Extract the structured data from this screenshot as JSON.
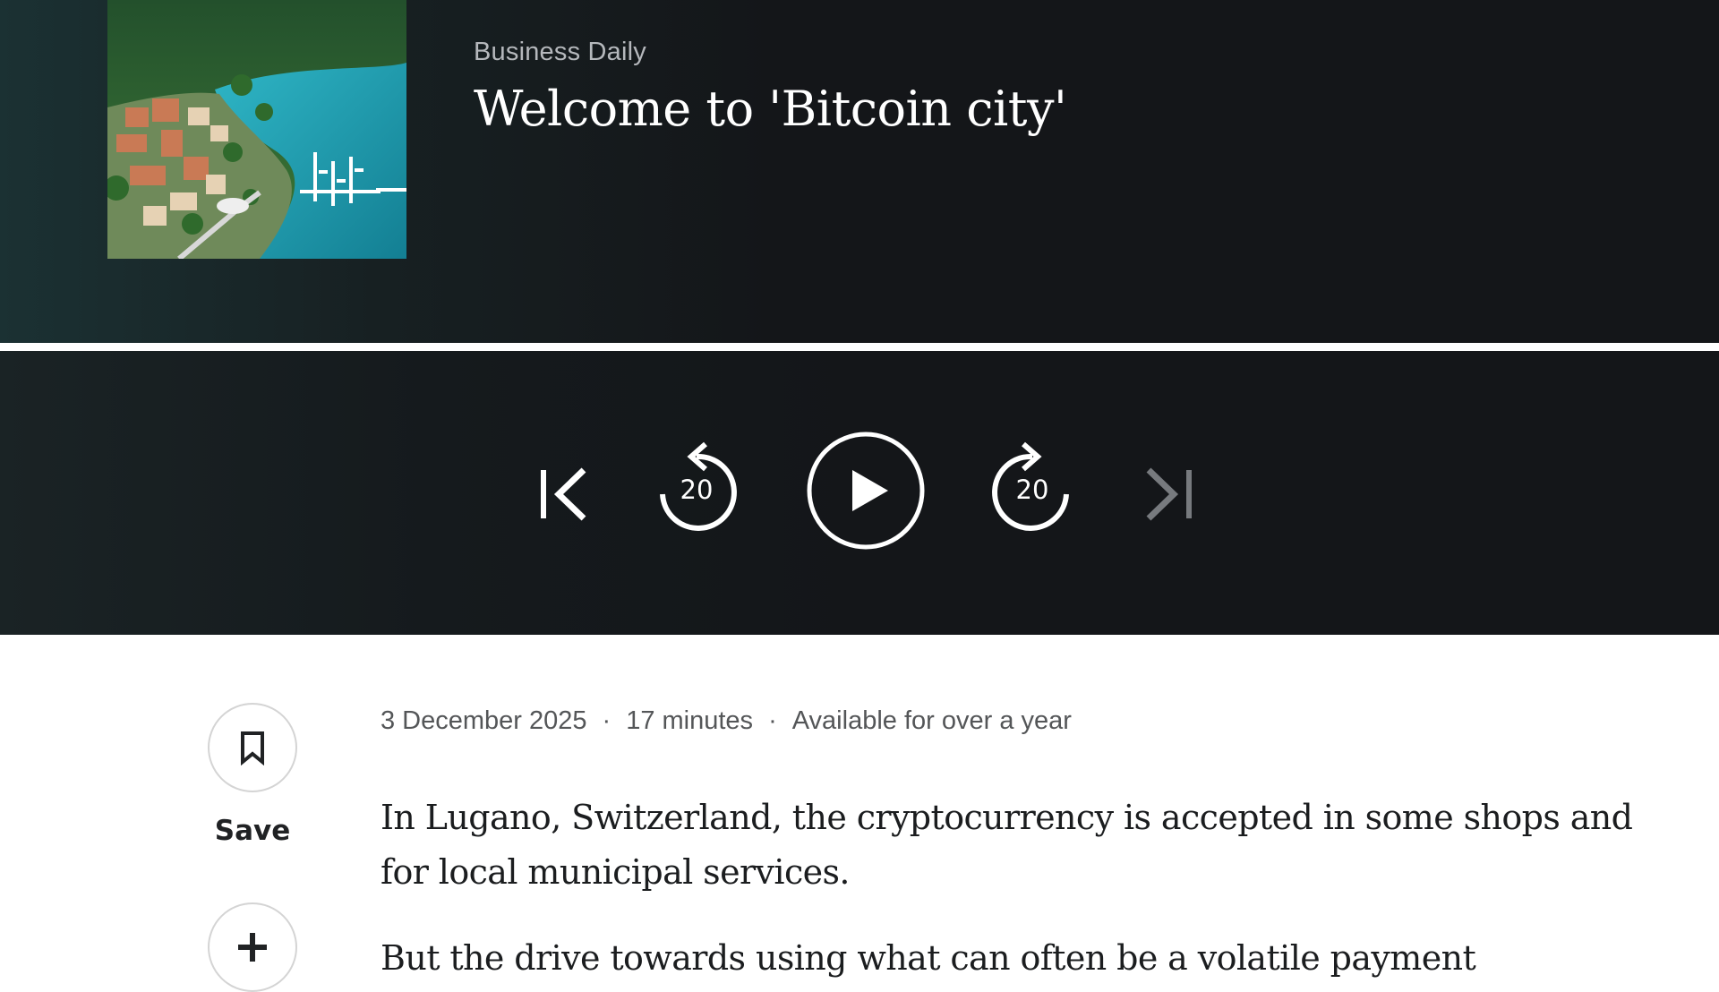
{
  "episode": {
    "show_name": "Business Daily",
    "title": "Welcome to 'Bitcoin city'",
    "artwork_icon": "lakeside-town-artwork"
  },
  "player": {
    "progress": 1.0,
    "rewind_seconds": "20",
    "forward_seconds": "20",
    "icons": {
      "previous": "skip-previous-icon",
      "rewind": "rewind-20-icon",
      "play": "play-icon",
      "forward": "forward-20-icon",
      "next": "skip-next-icon"
    }
  },
  "meta": {
    "date": "3 December 2025",
    "duration": "17 minutes",
    "availability": "Available for over a year",
    "separator": "·"
  },
  "actions": {
    "save_label": "Save",
    "save_icon": "bookmark-icon",
    "add_icon": "plus-icon"
  },
  "description": [
    "In Lugano, Switzerland, the cryptocurrency is accepted in some shops and for local municipal services.",
    "But the drive towards using what can often be a volatile payment"
  ],
  "colors": {
    "hero_background": "#141619",
    "text_on_dark": "#ffffff",
    "secondary_text": "#b5b8bc",
    "body_text": "#1b1d1f"
  }
}
